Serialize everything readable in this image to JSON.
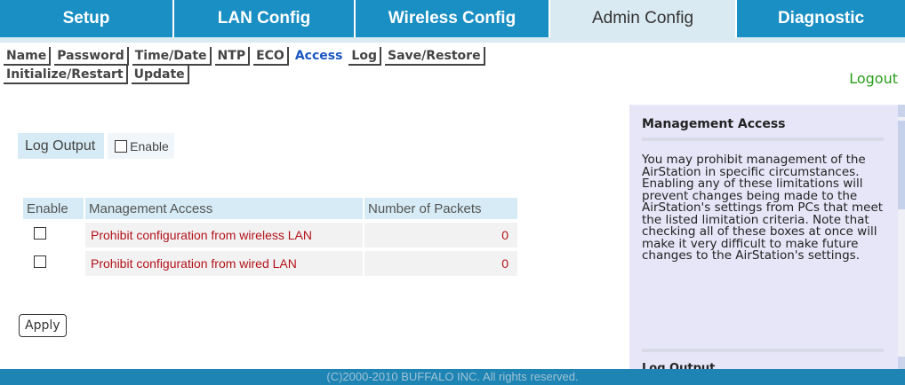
{
  "tabs": [
    {
      "label": "Setup",
      "active": false
    },
    {
      "label": "LAN Config",
      "active": false
    },
    {
      "label": "Wireless Config",
      "active": false
    },
    {
      "label": "Admin Config",
      "active": true
    },
    {
      "label": "Diagnostic",
      "active": false
    }
  ],
  "subnav": {
    "row1": [
      "Name",
      "Password",
      "Time/Date",
      "NTP",
      "ECO",
      "Access",
      "Log",
      "Save/Restore"
    ],
    "row2": [
      "Initialize/Restart",
      "Update"
    ],
    "active": "Access"
  },
  "logout_label": "Logout",
  "log_output": {
    "label": "Log Output",
    "checkbox_label": "Enable",
    "checked": false
  },
  "table": {
    "headers": [
      "Enable",
      "Management Access",
      "Number of Packets"
    ],
    "rows": [
      {
        "checked": false,
        "name": "Prohibit configuration from wireless LAN",
        "packets": "0"
      },
      {
        "checked": false,
        "name": "Prohibit configuration from wired LAN",
        "packets": "0"
      }
    ]
  },
  "apply_label": "Apply",
  "help": {
    "title": "Management Access",
    "text": "You may prohibit management of the AirStation in specific circumstances. Enabling any of these limitations will prevent changes being made to the AirStation's settings from PCs that meet the listed limitation criteria. Note that checking all of these boxes at once will make it very difficult to make future changes to the AirStation's settings.",
    "next_title": "Log Output"
  },
  "footer_text": "(C)2000-2010 BUFFALO INC. All rights reserved.",
  "colors": {
    "tab_bg": "#1a8fc4",
    "tab_active_bg": "#d9eaf2",
    "logout": "#2a9d1a",
    "row_text": "#b4121a",
    "help_bg": "#e7e6f8",
    "footer_bg": "#1e84b4"
  }
}
